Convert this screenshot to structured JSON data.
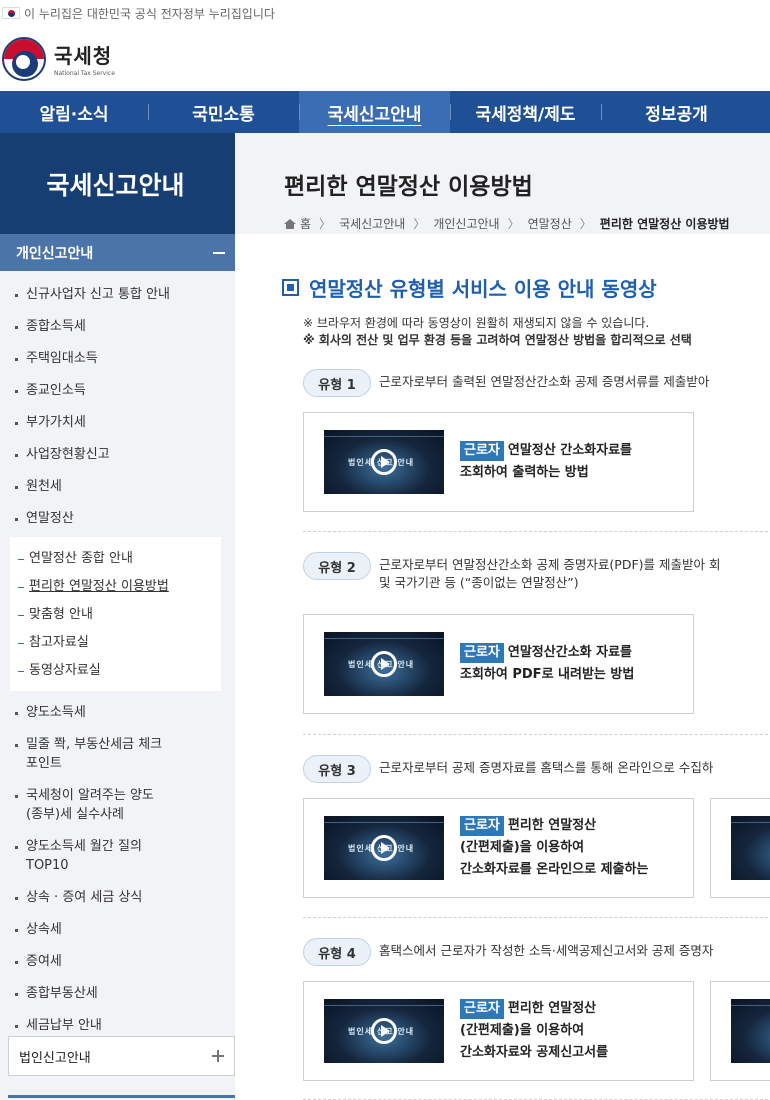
{
  "gov_banner": {
    "text": "이 누리집은 대한민국 공식 전자정부 누리집입니다"
  },
  "logo": {
    "name_ko": "국세청",
    "name_en": "National Tax Service"
  },
  "gnb": [
    {
      "label": "알림·소식"
    },
    {
      "label": "국민소통"
    },
    {
      "label": "국세신고안내"
    },
    {
      "label": "국세정책/제도"
    },
    {
      "label": "정보공개"
    }
  ],
  "sidebar": {
    "title": "국세신고안내",
    "section": "개인신고안내",
    "items_top": [
      "신규사업자 신고 통합 안내",
      "종합소득세",
      "주택임대소득",
      "종교인소득",
      "부가가치세",
      "사업장현황신고",
      "원천세",
      "연말정산"
    ],
    "sub_items": [
      "연말정산 종합 안내",
      "편리한 연말정산 이용방법",
      "맞춤형 안내",
      "참고자료실",
      "동영상자료실"
    ],
    "items_bottom": [
      "양도소득세",
      "밀줄 쫙, 부동산세금 체크포인트",
      "국세청이 알려주는 양도(종부)세 실수사례",
      "양도소득세 월간 질의 TOP10",
      "상속 · 증여 세금 상식",
      "상속세",
      "증여세",
      "종합부동산세",
      "세금납부 안내"
    ],
    "collapsed_section": "법인신고안내"
  },
  "page": {
    "title": "편리한 연말정산 이용방법",
    "breadcrumb": [
      "홈",
      "국세신고안내",
      "개인신고안내",
      "연말정산",
      "편리한 연말정산 이용방법"
    ],
    "section_title": "연말정산 유형별 서비스 이용 안내 동영상",
    "notice_1": "※ 브라우저 환경에 따라 동영상이 원활히 재생되지 않을 수 있습니다.",
    "notice_2": "※ 회사의 전산 및 업무 환경 등을 고려하여 연말정산 방법을 합리적으로 선택"
  },
  "types": [
    {
      "badge": "유형 1",
      "desc": [
        "근로자로부터 출력된 연말정산간소화 공제 증명서류를 제출받아"
      ],
      "cards": [
        {
          "tag": "근로자",
          "line1": "연말정산 간소화자료를",
          "line2": "조회하여 출력하는 방법",
          "line3": "",
          "thumb_label": "법인세 신고 안내"
        }
      ]
    },
    {
      "badge": "유형 2",
      "desc": [
        "근로자로부터 연말정산간소화 공제 증명자료(PDF)를 제출받아 회",
        "및 국가기관 등 (“종이없는 연말정산”)"
      ],
      "cards": [
        {
          "tag": "근로자",
          "line1": "연말정산간소화 자료를",
          "line2": "조회하여 PDF로 내려받는 방법",
          "line3": "",
          "thumb_label": "법인세 신고 안내"
        }
      ]
    },
    {
      "badge": "유형 3",
      "desc": [
        "근로자로부터 공제 증명자료를 홈택스를 통해 온라인으로 수집하"
      ],
      "cards": [
        {
          "tag": "근로자",
          "line1": "편리한 연말정산",
          "line2": "(간편제출)을 이용하여",
          "line3": "간소화자료를 온라인으로 제출하는",
          "thumb_label": "법인세 신고 안내"
        },
        {
          "tag": "",
          "line1": "",
          "line2": "",
          "line3": "",
          "thumb_label": ""
        }
      ]
    },
    {
      "badge": "유형 4",
      "desc": [
        "홈택스에서 근로자가 작성한 소득·세액공제신고서와 공제 증명자"
      ],
      "cards": [
        {
          "tag": "근로자",
          "line1": "편리한 연말정산",
          "line2": "(간편제출)을 이용하여",
          "line3": "간소화자료와 공제신고서를",
          "thumb_label": "법인세 신고 안내"
        },
        {
          "tag": "",
          "line1": "",
          "line2": "",
          "line3": "",
          "thumb_label": ""
        }
      ]
    }
  ]
}
